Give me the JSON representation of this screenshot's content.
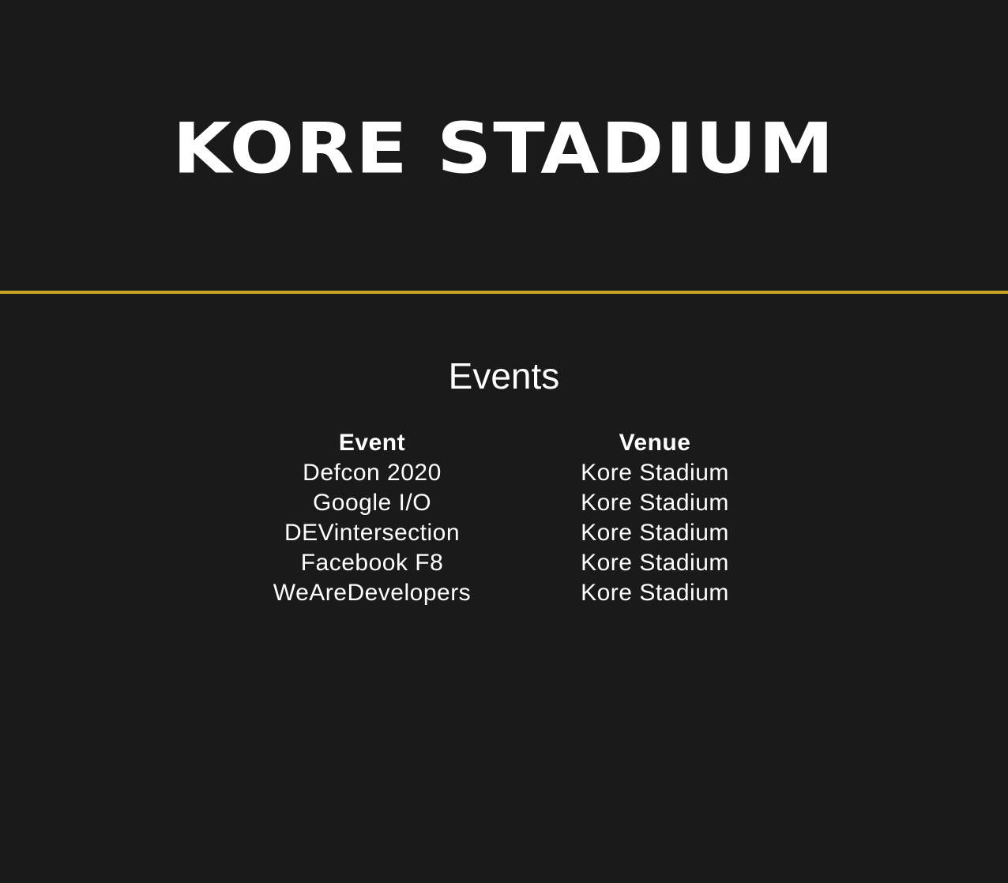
{
  "hero": {
    "title": "KORE STADIUM"
  },
  "events": {
    "heading": "Events",
    "columns": [
      "Event",
      "Venue"
    ],
    "rows": [
      {
        "event": "Defcon 2020",
        "venue": "Kore Stadium"
      },
      {
        "event": "Google I/O",
        "venue": "Kore Stadium"
      },
      {
        "event": "DEVintersection",
        "venue": "Kore Stadium"
      },
      {
        "event": "Facebook F8",
        "venue": "Kore Stadium"
      },
      {
        "event": "WeAreDevelopers",
        "venue": "Kore Stadium"
      }
    ]
  },
  "colors": {
    "background": "#1a1a1a",
    "divider": "#c9a227",
    "text": "#ffffff"
  }
}
